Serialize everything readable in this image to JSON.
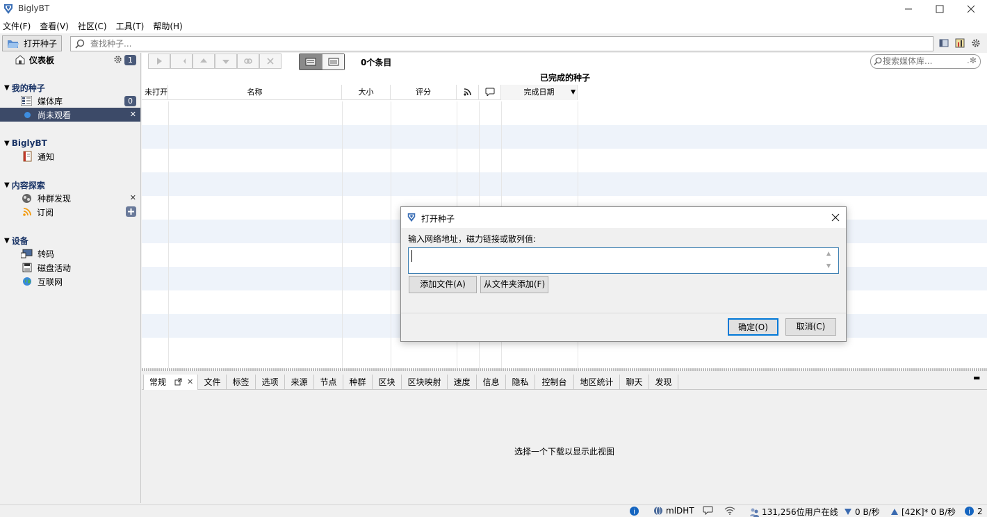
{
  "window": {
    "title": "BiglyBT"
  },
  "menu": [
    "文件(F)",
    "查看(V)",
    "社区(C)",
    "工具(T)",
    "帮助(H)"
  ],
  "toolbar": {
    "open_torrent_label": "打开种子",
    "search_placeholder": "查找种子..."
  },
  "sidebar": {
    "dashboard": {
      "label": "仪表板",
      "badge": "1"
    },
    "my_torrents": {
      "header": "我的种子",
      "library": "媒体库",
      "library_badge": "0",
      "unwatched": "尚未观看"
    },
    "biglybt": {
      "header": "BiglyBT",
      "notifications": "通知"
    },
    "discovery": {
      "header": "内容探索",
      "swarm": "种群发现",
      "subscriptions": "订阅"
    },
    "devices": {
      "header": "设备",
      "transcode": "转码",
      "disk": "磁盘活动",
      "internet": "互联网"
    }
  },
  "main": {
    "item_count": "0个条目",
    "view_title": "已完成的种子",
    "media_search_placeholder": "搜索媒体库...",
    "columns": [
      "未打开",
      "名称",
      "大小",
      "评分",
      "完成日期"
    ]
  },
  "bottom": {
    "tabs": [
      "常规",
      "文件",
      "标签",
      "选项",
      "来源",
      "节点",
      "种群",
      "区块",
      "区块映射",
      "速度",
      "信息",
      "隐私",
      "控制台",
      "地区统计",
      "聊天",
      "发现"
    ],
    "empty_message": "选择一个下载以显示此视图"
  },
  "status": {
    "dht": "mlDHT",
    "users_online": "131,256位用户在线",
    "down": "0 B/秒",
    "up": "[42K]* 0 B/秒",
    "info_count": "2"
  },
  "dialog": {
    "title": "打开种子",
    "prompt": "输入网络地址，磁力链接或散列值:",
    "input_value": "",
    "add_file": "添加文件(A)",
    "add_folder": "从文件夹添加(F)",
    "ok": "确定(O)",
    "cancel": "取消(C)"
  },
  "colors": {
    "accent": "#1a3466",
    "selected_row": "#3c4a68",
    "stripe": "#eef3fa",
    "dialog_border": "#3c7fb1"
  }
}
